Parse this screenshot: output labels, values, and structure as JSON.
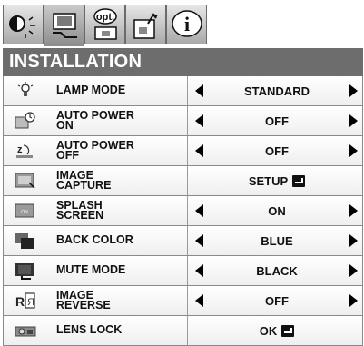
{
  "tabs": [
    {
      "name": "picture-tab-icon",
      "label": ""
    },
    {
      "name": "installation-tab-icon",
      "label": ""
    },
    {
      "name": "options-tab-icon",
      "label": "opt."
    },
    {
      "name": "signal-tab-icon",
      "label": ""
    },
    {
      "name": "info-tab-icon",
      "label": "i"
    }
  ],
  "menu": {
    "title": "INSTALLATION",
    "items": [
      {
        "label": "LAMP MODE",
        "value": "STANDARD",
        "icon": "lamp-icon",
        "arrows": true
      },
      {
        "label": "AUTO POWER\nON",
        "value": "OFF",
        "icon": "power-on-timer-icon",
        "arrows": true
      },
      {
        "label": "AUTO POWER\nOFF",
        "value": "OFF",
        "icon": "sleep-icon",
        "arrows": true
      },
      {
        "label": "IMAGE\nCAPTURE",
        "value": "SETUP",
        "icon": "image-capture-icon",
        "arrows": false,
        "enter": true
      },
      {
        "label": "SPLASH\nSCREEN",
        "value": "ON",
        "icon": "splash-screen-icon",
        "arrows": true
      },
      {
        "label": "BACK COLOR",
        "value": "BLUE",
        "icon": "back-color-icon",
        "arrows": true
      },
      {
        "label": "MUTE MODE",
        "value": "BLACK",
        "icon": "mute-mode-icon",
        "arrows": true
      },
      {
        "label": "IMAGE\nREVERSE",
        "value": "OFF",
        "icon": "image-reverse-icon",
        "arrows": true
      },
      {
        "label": "LENS LOCK",
        "value": "OK",
        "icon": "lens-lock-icon",
        "arrows": false,
        "enter": true
      }
    ]
  },
  "colors": {
    "title_bg": "#6d6d6d",
    "row_border": "#8a8a8a"
  }
}
